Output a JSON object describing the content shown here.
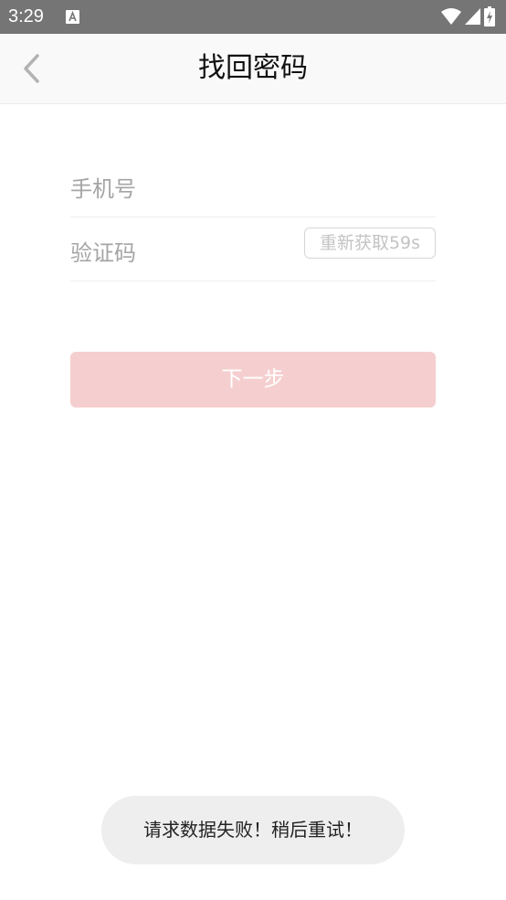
{
  "status_bar": {
    "time": "3:29",
    "icons": [
      "a-icon",
      "wifi-icon",
      "signal-icon",
      "battery-charging-icon"
    ]
  },
  "header": {
    "title": "找回密码",
    "back_icon": "chevron-left-icon"
  },
  "form": {
    "phone": {
      "placeholder": "手机号",
      "value": ""
    },
    "code": {
      "placeholder": "验证码",
      "value": "",
      "resend_label": "重新获取59s"
    },
    "next_label": "下一步"
  },
  "toast": {
    "message": "请求数据失败！稍后重试！"
  },
  "colors": {
    "status_bar": "#757575",
    "header_bg": "#f9f9f9",
    "button_disabled": "#f5cfcf",
    "toast_bg": "#eeeeee"
  }
}
